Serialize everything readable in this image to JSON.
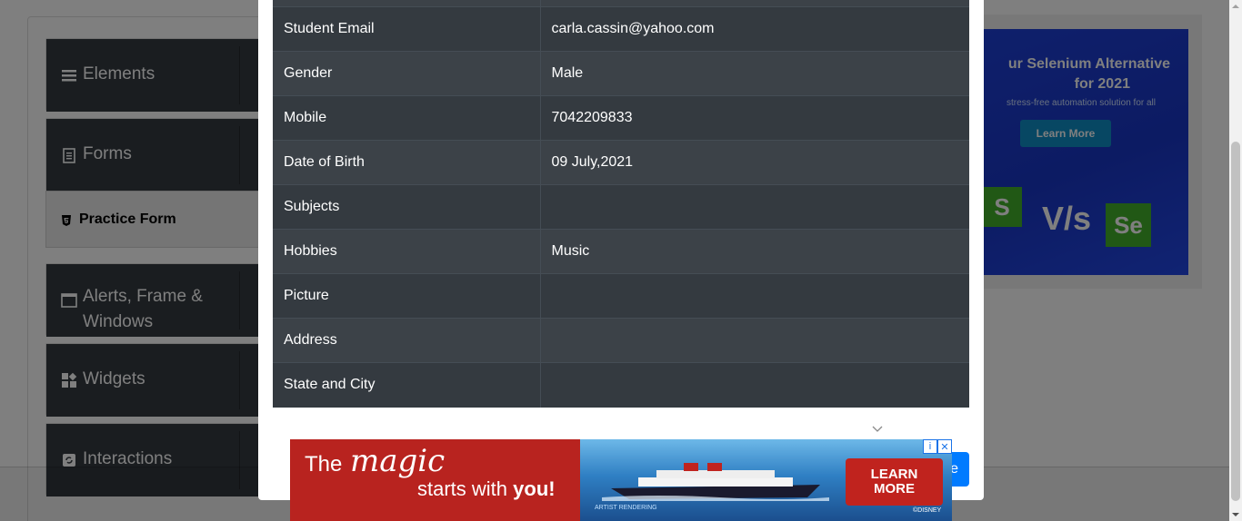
{
  "sidebar": {
    "groups": [
      {
        "label": "Elements",
        "icon": "hamburger-icon"
      },
      {
        "label": "Forms",
        "icon": "document-icon"
      },
      {
        "label": "Alerts, Frame & Windows",
        "icon": "window-icon"
      },
      {
        "label": "Widgets",
        "icon": "widgets-icon"
      },
      {
        "label": "Interactions",
        "icon": "interactions-icon"
      }
    ],
    "active_item": "Practice Form"
  },
  "modal": {
    "rows": [
      {
        "label": "Student Email",
        "value": "carla.cassin@yahoo.com"
      },
      {
        "label": "Gender",
        "value": "Male"
      },
      {
        "label": "Mobile",
        "value": "7042209833"
      },
      {
        "label": "Date of Birth",
        "value": "09 July,2021"
      },
      {
        "label": "Subjects",
        "value": ""
      },
      {
        "label": "Hobbies",
        "value": "Music"
      },
      {
        "label": "Picture",
        "value": ""
      },
      {
        "label": "Address",
        "value": ""
      },
      {
        "label": "State and City",
        "value": ""
      }
    ],
    "close_button_partial": "e"
  },
  "ad_right": {
    "title_line1": "ur Selenium Alternative",
    "title_line2": "for 2021",
    "subtitle": "stress-free automation solution for all",
    "button": "Learn More",
    "vs": "V/s",
    "logo_left": "S",
    "logo_right": "Se"
  },
  "ad_bottom": {
    "the": "The",
    "magic": "magic",
    "starts_with": "starts with",
    "you": "you!",
    "button_line1": "LEARN",
    "button_line2": "MORE",
    "artist": "ARTIST RENDERING",
    "disney": "©DISNEY"
  },
  "colors": {
    "table_odd": "#3c4248",
    "table_even": "#343a40",
    "primary": "#007bff",
    "ad_red": "#b8231f"
  }
}
